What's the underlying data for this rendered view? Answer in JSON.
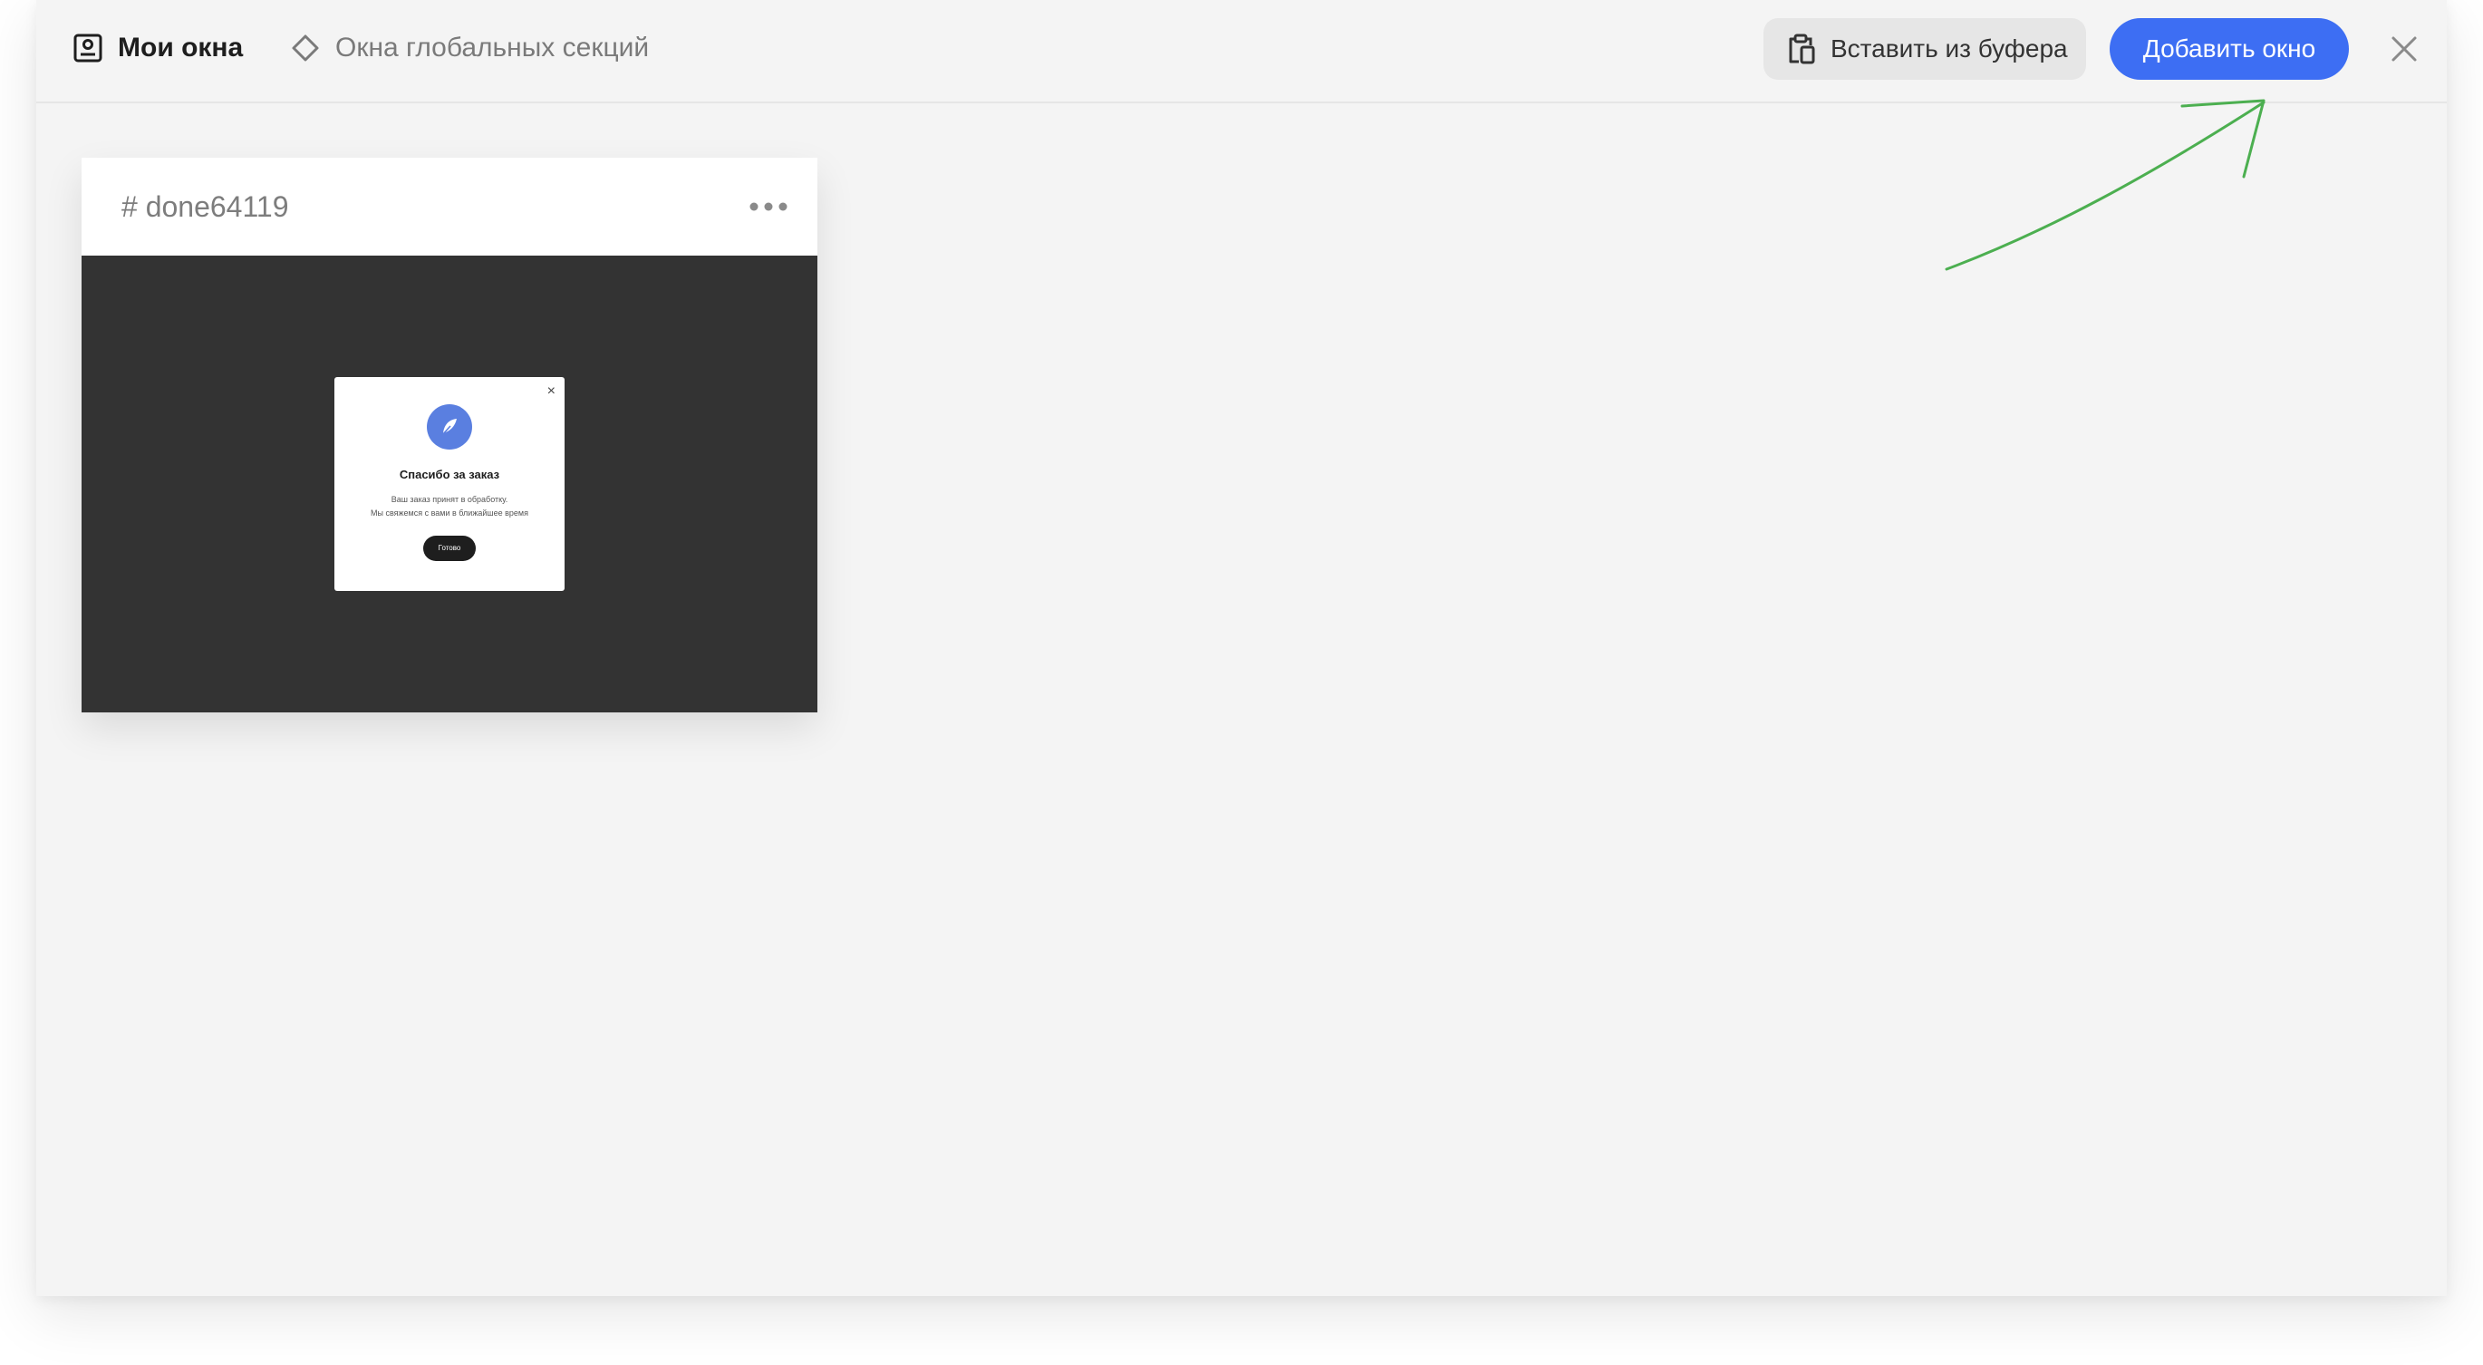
{
  "tabs": {
    "my_windows": "Мои окна",
    "global_windows": "Окна глобальных секций"
  },
  "toolbar": {
    "paste_label": "Вставить из буфера",
    "add_label": "Добавить окно"
  },
  "icons": {
    "my_windows": "profile-window-icon",
    "global_windows": "diamond-icon",
    "paste": "clipboard-icon",
    "close": "close-icon",
    "card_menu": "more-dots-icon",
    "popup_logo": "feather-icon"
  },
  "colors": {
    "accent": "#3d6ef3",
    "arrow": "#4caf50",
    "preview_bg": "#333333",
    "popup_icon": "#5a7fe0"
  },
  "cards": [
    {
      "title": "# done64119",
      "preview": {
        "heading": "Спасибо за заказ",
        "line1": "Ваш заказ принят в обработку.",
        "line2": "Мы свяжемся с вами в ближайшее время",
        "button": "Готово",
        "close": "×"
      }
    }
  ]
}
